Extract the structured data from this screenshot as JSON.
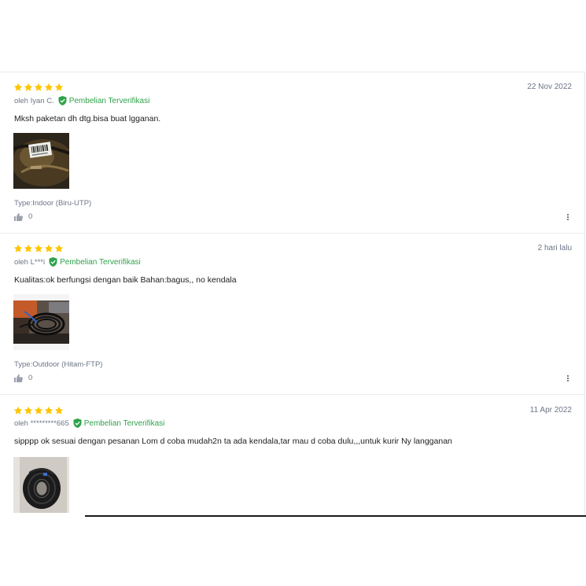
{
  "reviews": [
    {
      "rating": 5,
      "date": "22 Nov 2022",
      "author": "oleh Iyan C.",
      "verified_label": "Pembelian Terverifikasi",
      "text": "Mksh paketan dh dtg.bisa buat lgganan.",
      "variant": "Type:Indoor (Biru-UTP)",
      "likes": "0"
    },
    {
      "rating": 5,
      "date": "2 hari lalu",
      "author": "oleh L***i",
      "verified_label": "Pembelian Terverifikasi",
      "text": "Kualitas:ok berfungsi dengan baik Bahan:bagus,, no kendala",
      "variant": "Type:Outdoor (Hitam-FTP)",
      "likes": "0"
    },
    {
      "rating": 5,
      "date": "11 Apr 2022",
      "author": "oleh *********665",
      "verified_label": "Pembelian Terverifikasi",
      "text": "sipppp ok sesuai dengan pesanan Lom d coba mudah2n ta ada kendala,tar mau d coba dulu,,,untuk kurir Ny langganan"
    }
  ],
  "colors": {
    "star": "#ffc400",
    "verified": "#31a24c",
    "muted_text": "#6d7588"
  },
  "icons": {
    "rating": "star-icon",
    "verified": "verified-shield-icon",
    "like": "thumbs-up-icon",
    "menu": "more-vertical-icon"
  }
}
